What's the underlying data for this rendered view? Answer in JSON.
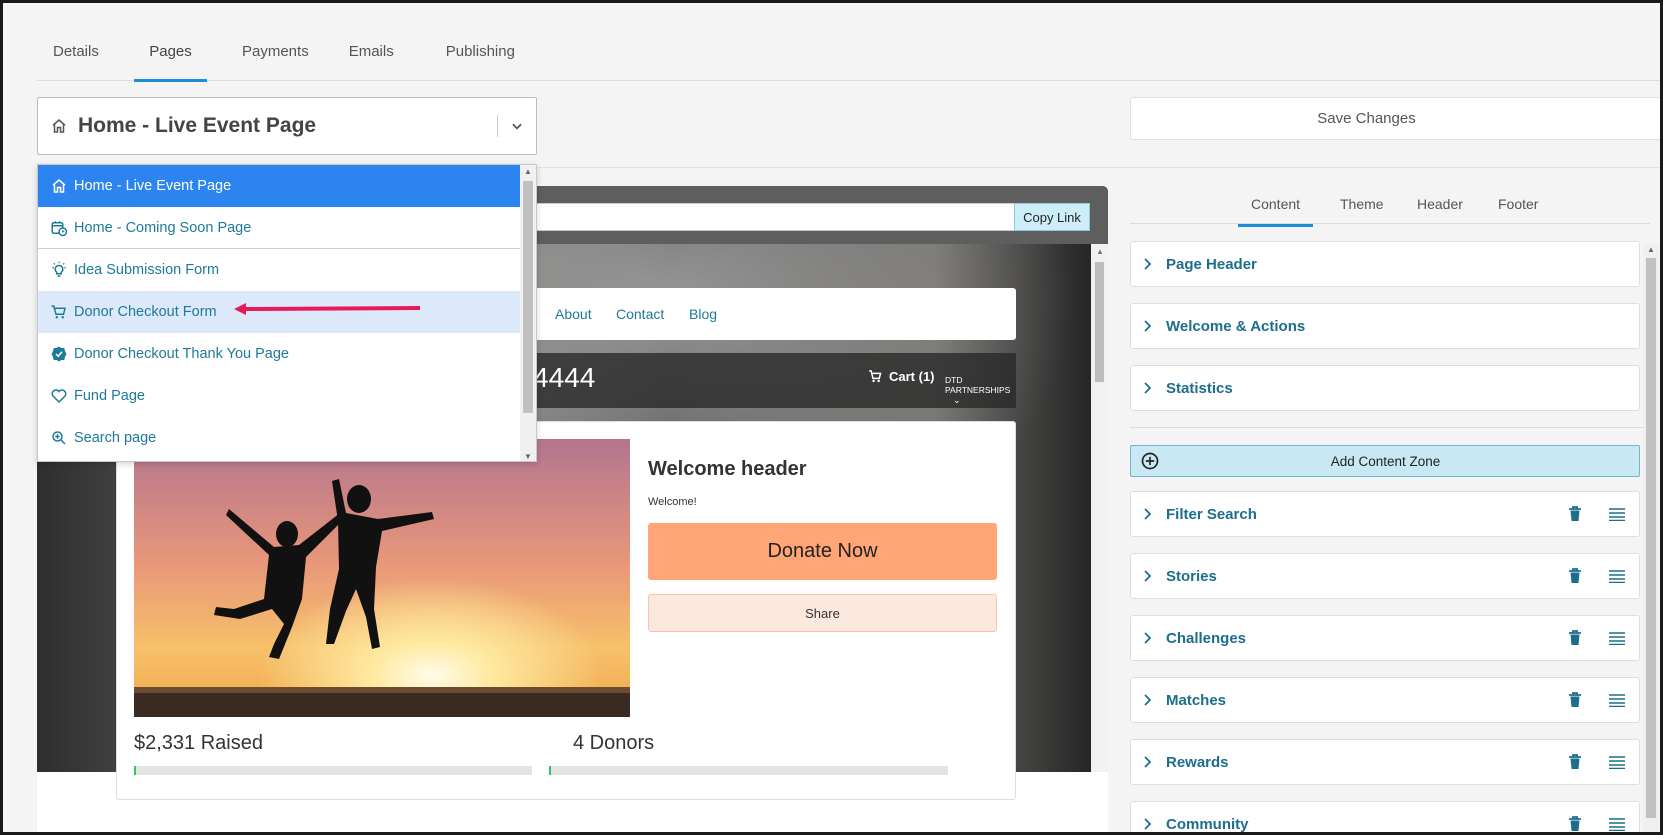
{
  "tabs": [
    {
      "label": "Details"
    },
    {
      "label": "Pages"
    },
    {
      "label": "Payments"
    },
    {
      "label": "Emails"
    },
    {
      "label": "Publishing"
    }
  ],
  "active_tab": "Pages",
  "page_select": {
    "value": "Home - Live Event Page",
    "icon": "home-icon"
  },
  "dropdown": {
    "items": [
      {
        "label": "Home - Live Event Page",
        "icon": "home-icon",
        "state": "selected"
      },
      {
        "label": "Home - Coming Soon Page",
        "icon": "calendar-clock-icon",
        "state": ""
      },
      {
        "label": "Idea Submission Form",
        "icon": "lightbulb-icon",
        "state": ""
      },
      {
        "label": "Donor Checkout Form",
        "icon": "cart-icon",
        "state": "hovered"
      },
      {
        "label": "Donor Checkout Thank You Page",
        "icon": "verified-badge-icon",
        "state": ""
      },
      {
        "label": "Fund Page",
        "icon": "heart-icon",
        "state": ""
      },
      {
        "label": "Search page",
        "icon": "zoom-search-icon",
        "state": ""
      }
    ]
  },
  "toolbar": {
    "save_label": "Save Changes"
  },
  "preview": {
    "copy_link_label": "Copy Link",
    "url_value": "",
    "nav": {
      "about": "About",
      "contact": "Contact",
      "blog": "Blog"
    },
    "header": {
      "phone_partial": "4444",
      "cart": "Cart (1)",
      "partner": "DTD PARTNERSHIPS"
    },
    "welcome_header": "Welcome header",
    "welcome_text": "Welcome!",
    "donate_label": "Donate Now",
    "share_label": "Share",
    "raised": "$2,331 Raised",
    "donors": "4 Donors",
    "raised_progress": 0.005,
    "donors_progress": 0.005
  },
  "right_panel": {
    "tabs": [
      "Content",
      "Theme",
      "Header",
      "Footer"
    ],
    "active_tab": "Content",
    "fixed_sections": [
      "Page Header",
      "Welcome & Actions",
      "Statistics"
    ],
    "add_zone_label": "Add Content Zone",
    "zones": [
      "Filter Search",
      "Stories",
      "Challenges",
      "Matches",
      "Rewards",
      "Community"
    ]
  },
  "colors": {
    "accent": "#1e8fd6",
    "selected_item": "#2b84f0",
    "link": "#1f7a99",
    "donate": "#ffa576",
    "annotation_arrow": "#e8195a"
  }
}
